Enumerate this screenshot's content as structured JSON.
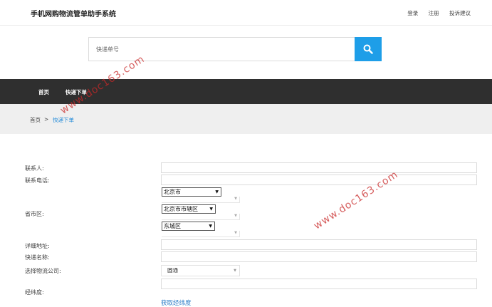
{
  "header": {
    "site_title": "手机网购物流管单助手系统",
    "links": [
      "登录",
      "注册",
      "投诉建议"
    ]
  },
  "search": {
    "placeholder": "快递单号",
    "button_icon": "search-icon",
    "button_color": "#1e9ee8"
  },
  "nav": {
    "items": [
      "首页",
      "快递下单"
    ]
  },
  "breadcrumb": {
    "home": "首页",
    "separator": ">",
    "current": "快递下单"
  },
  "form": {
    "contact_label": "联系人:",
    "phone_label": "联系电话:",
    "region_label": "省市区:",
    "province": "北京市",
    "city": "北京市市辖区",
    "district": "东城区",
    "address_label": "详细地址:",
    "express_name_label": "快递名称:",
    "company_label": "选择物流公司:",
    "company_value": "圆通",
    "latlng_label": "经纬度:",
    "latlng_link": "获取经纬度"
  },
  "watermark": {
    "text": "www.doc163.com",
    "color": "#c82828"
  }
}
